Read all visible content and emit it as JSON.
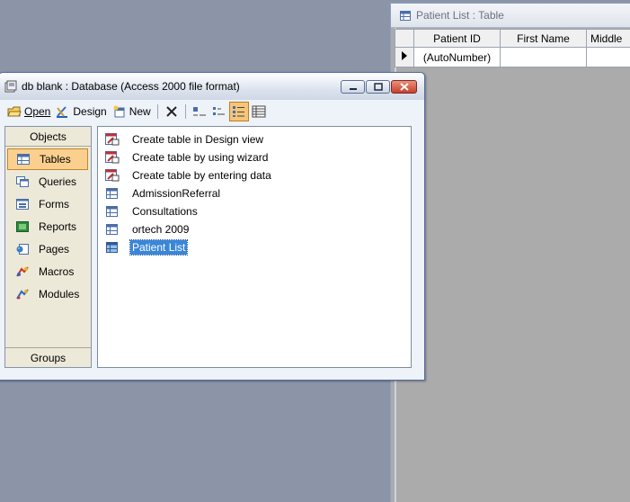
{
  "table_window": {
    "title": "Patient List : Table",
    "columns": [
      "Patient ID",
      "First Name",
      "Middle"
    ],
    "rows": [
      [
        "(AutoNumber)",
        "",
        ""
      ]
    ]
  },
  "db_window": {
    "title": "db blank : Database (Access 2000 file format)",
    "toolbar": {
      "open_label": "Open",
      "design_label": "Design",
      "new_label": "New"
    },
    "objects": {
      "header": "Objects",
      "items": [
        {
          "label": "Tables",
          "icon": "table-icon"
        },
        {
          "label": "Queries",
          "icon": "query-icon"
        },
        {
          "label": "Forms",
          "icon": "form-icon"
        },
        {
          "label": "Reports",
          "icon": "report-icon"
        },
        {
          "label": "Pages",
          "icon": "page-icon"
        },
        {
          "label": "Macros",
          "icon": "macro-icon"
        },
        {
          "label": "Modules",
          "icon": "module-icon"
        }
      ],
      "groups_label": "Groups"
    },
    "list": [
      {
        "label": "Create table in Design view",
        "icon": "shortcut-icon"
      },
      {
        "label": "Create table by using wizard",
        "icon": "shortcut-icon"
      },
      {
        "label": "Create table by entering data",
        "icon": "shortcut-icon"
      },
      {
        "label": "AdmissionReferral",
        "icon": "table-icon"
      },
      {
        "label": "Consultations",
        "icon": "table-icon"
      },
      {
        "label": "ortech 2009",
        "icon": "table-icon"
      },
      {
        "label": "Patient List",
        "icon": "table-icon",
        "selected": true
      }
    ]
  },
  "colors": {
    "desktop": "#8b95a7",
    "selection": "#3a86d8",
    "active_highlight": "#fbd08f"
  }
}
